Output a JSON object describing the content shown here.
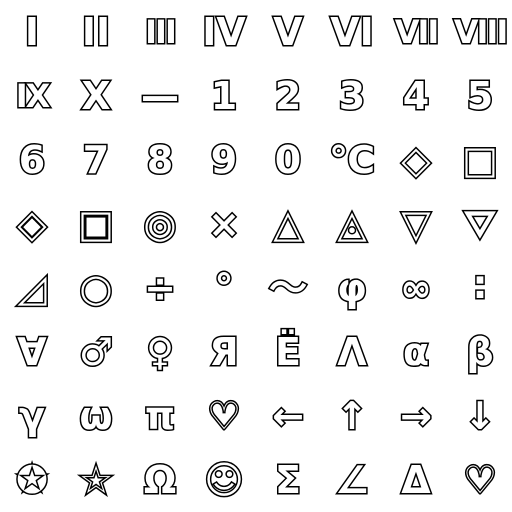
{
  "sheet": {
    "rows": [
      [
        {
          "name": "roman-numeral-one-icon",
          "glyph": "I"
        },
        {
          "name": "roman-numeral-two-icon",
          "glyph": "II"
        },
        {
          "name": "roman-numeral-three-icon",
          "glyph": "III"
        },
        {
          "name": "roman-numeral-four-icon",
          "glyph": "IV"
        },
        {
          "name": "roman-numeral-five-icon",
          "glyph": "V"
        },
        {
          "name": "roman-numeral-six-icon",
          "glyph": "VI"
        },
        {
          "name": "roman-numeral-seven-icon",
          "glyph": "VII"
        },
        {
          "name": "roman-numeral-eight-icon",
          "glyph": "VIII"
        }
      ],
      [
        {
          "name": "roman-numeral-nine-icon",
          "glyph": "IX"
        },
        {
          "name": "roman-numeral-ten-icon",
          "glyph": "X"
        },
        {
          "name": "dash-icon",
          "glyph": "—"
        },
        {
          "name": "digit-one-icon",
          "glyph": "1"
        },
        {
          "name": "digit-two-icon",
          "glyph": "2"
        },
        {
          "name": "digit-three-icon",
          "glyph": "3"
        },
        {
          "name": "digit-four-icon",
          "glyph": "4"
        },
        {
          "name": "digit-five-icon",
          "glyph": "5"
        }
      ],
      [
        {
          "name": "digit-six-icon",
          "glyph": "6"
        },
        {
          "name": "digit-seven-icon",
          "glyph": "7"
        },
        {
          "name": "digit-eight-icon",
          "glyph": "8"
        },
        {
          "name": "digit-nine-icon",
          "glyph": "9"
        },
        {
          "name": "digit-zero-icon",
          "glyph": "0"
        },
        {
          "name": "degree-celsius-icon",
          "glyph": "℃"
        },
        {
          "name": "diamond-outline-icon",
          "glyph": "◇"
        },
        {
          "name": "square-outline-icon",
          "glyph": "□"
        }
      ],
      [
        {
          "name": "diamond-double-icon",
          "glyph": "◈"
        },
        {
          "name": "square-double-icon",
          "glyph": "▣"
        },
        {
          "name": "circle-double-icon",
          "glyph": "◎"
        },
        {
          "name": "multiply-icon",
          "glyph": "×"
        },
        {
          "name": "triangle-up-outline-icon",
          "glyph": "△"
        },
        {
          "name": "triangle-up-double-icon",
          "glyph": "◬"
        },
        {
          "name": "triangle-down-outline-icon",
          "glyph": "▽"
        },
        {
          "name": "triangle-down-double-icon",
          "glyph": "⛛"
        }
      ],
      [
        {
          "name": "right-triangle-icon",
          "glyph": "◿"
        },
        {
          "name": "circle-outline-icon",
          "glyph": "○"
        },
        {
          "name": "division-icon",
          "glyph": "÷"
        },
        {
          "name": "degree-icon",
          "glyph": "°"
        },
        {
          "name": "tilde-icon",
          "glyph": "〜"
        },
        {
          "name": "phi-icon",
          "glyph": "φ"
        },
        {
          "name": "infinity-icon",
          "glyph": "∞"
        },
        {
          "name": "ratio-icon",
          "glyph": "∶"
        }
      ],
      [
        {
          "name": "for-all-icon",
          "glyph": "∀"
        },
        {
          "name": "male-sign-icon",
          "glyph": "♂"
        },
        {
          "name": "female-sign-icon",
          "glyph": "♀"
        },
        {
          "name": "cyrillic-ya-icon",
          "glyph": "Я"
        },
        {
          "name": "cyrillic-yo-icon",
          "glyph": "Ё"
        },
        {
          "name": "lambda-icon",
          "glyph": "Λ"
        },
        {
          "name": "alpha-icon",
          "glyph": "α"
        },
        {
          "name": "beta-icon",
          "glyph": "β"
        }
      ],
      [
        {
          "name": "gamma-icon",
          "glyph": "γ"
        },
        {
          "name": "omega-lowercase-icon",
          "glyph": "ω"
        },
        {
          "name": "pi-icon",
          "glyph": "π"
        },
        {
          "name": "heart-outline-icon",
          "glyph": "♡"
        },
        {
          "name": "arrow-left-icon",
          "glyph": "←"
        },
        {
          "name": "arrow-up-icon",
          "glyph": "↑"
        },
        {
          "name": "arrow-right-icon",
          "glyph": "→"
        },
        {
          "name": "arrow-down-icon",
          "glyph": "↓"
        }
      ],
      [
        {
          "name": "star-double-outline-icon",
          "glyph": "✪"
        },
        {
          "name": "star-outline-icon",
          "glyph": "☆"
        },
        {
          "name": "omega-uppercase-icon",
          "glyph": "Ω"
        },
        {
          "name": "smiley-face-icon",
          "glyph": "☺"
        },
        {
          "name": "sigma-icon",
          "glyph": "Σ"
        },
        {
          "name": "angle-icon",
          "glyph": "∠"
        },
        {
          "name": "delta-icon",
          "glyph": "Δ"
        },
        {
          "name": "heart-double-outline-icon",
          "glyph": "♡"
        }
      ]
    ]
  },
  "colors": {
    "background": "#ffffff",
    "fill": "#ffffff",
    "stroke": "#000000"
  }
}
